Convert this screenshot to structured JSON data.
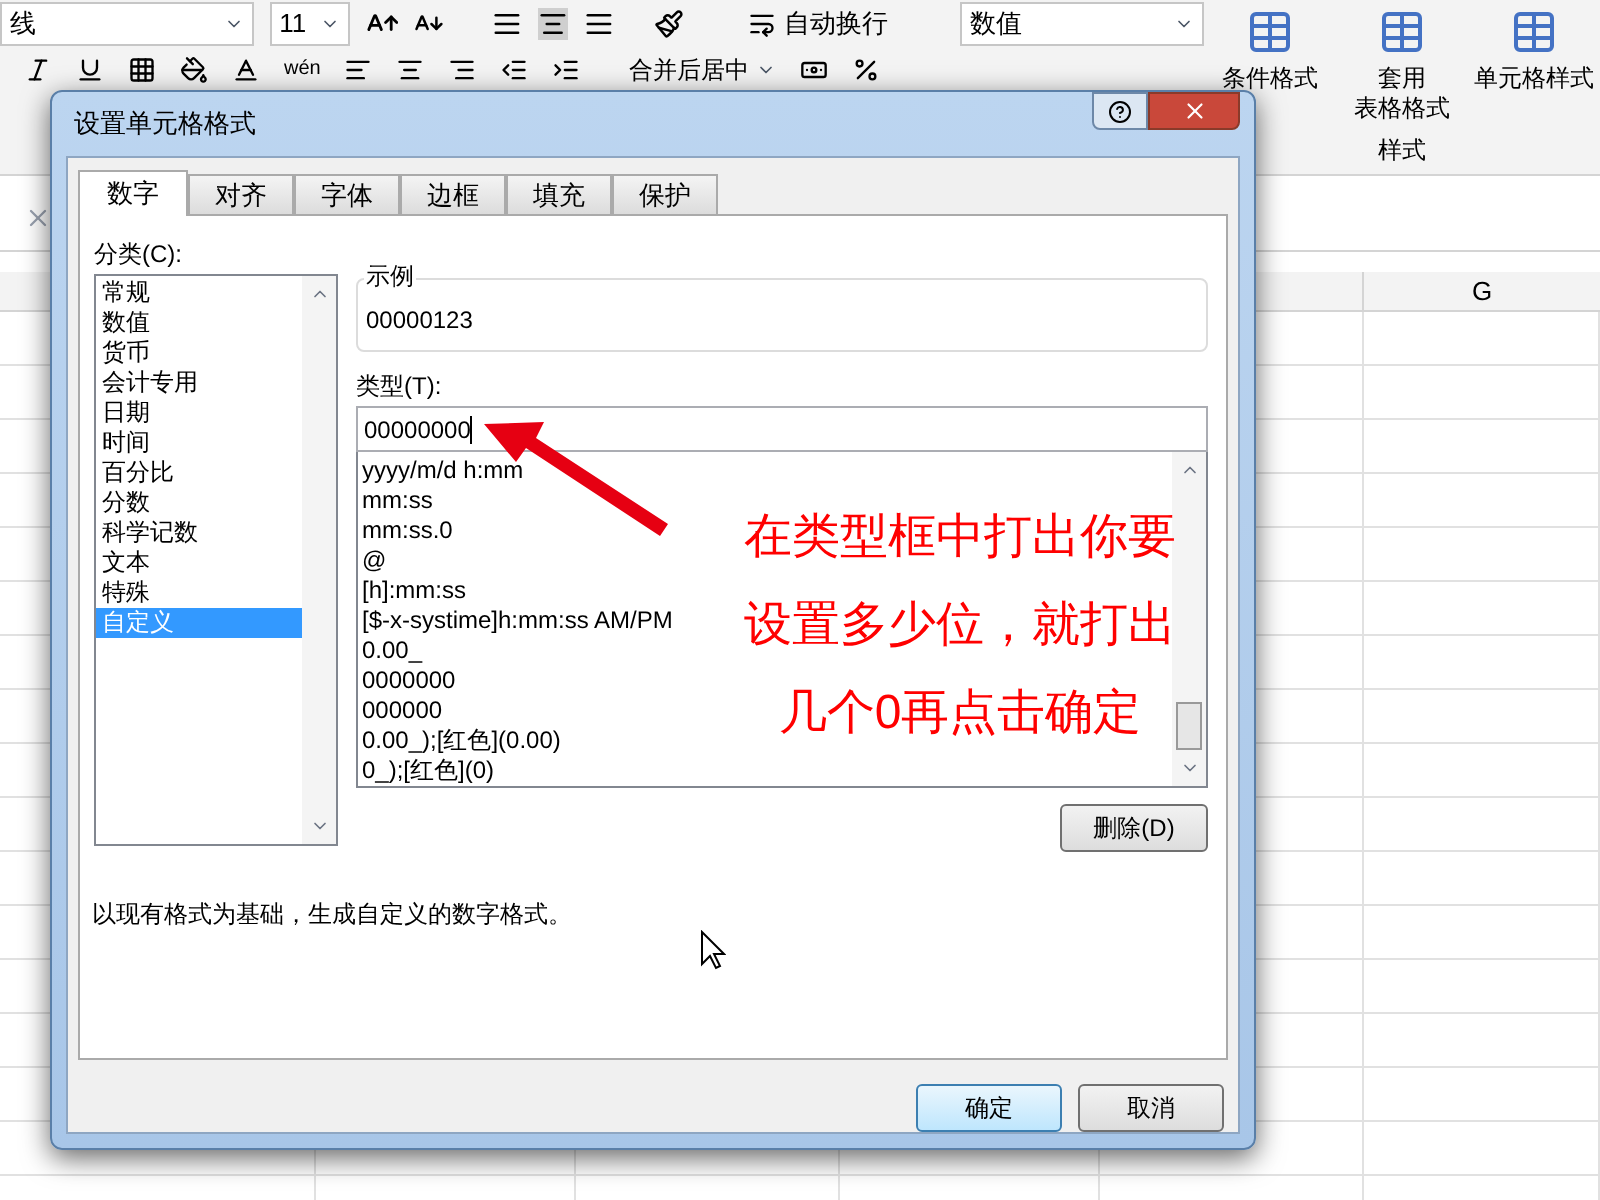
{
  "ribbon": {
    "font_name": "线",
    "font_size": "11",
    "wrap_text": "自动换行",
    "merge_center": "合并后居中",
    "number_format": "数值",
    "phonetic": "wén",
    "styles": [
      {
        "lines": [
          "条件格式"
        ]
      },
      {
        "lines": [
          "套用",
          "表格格式"
        ]
      },
      {
        "lines": [
          "单元格样式"
        ]
      }
    ],
    "group_label": "样式"
  },
  "sheet": {
    "visible_column": "G"
  },
  "dialog": {
    "title": "设置单元格格式",
    "tabs": [
      {
        "label": "数字",
        "selected": true
      },
      {
        "label": "对齐",
        "selected": false
      },
      {
        "label": "字体",
        "selected": false
      },
      {
        "label": "边框",
        "selected": false
      },
      {
        "label": "填充",
        "selected": false
      },
      {
        "label": "保护",
        "selected": false
      }
    ],
    "category_label": "分类(C):",
    "categories": [
      {
        "label": "常规",
        "selected": false
      },
      {
        "label": "数值",
        "selected": false
      },
      {
        "label": "货币",
        "selected": false
      },
      {
        "label": "会计专用",
        "selected": false
      },
      {
        "label": "日期",
        "selected": false
      },
      {
        "label": "时间",
        "selected": false
      },
      {
        "label": "百分比",
        "selected": false
      },
      {
        "label": "分数",
        "selected": false
      },
      {
        "label": "科学记数",
        "selected": false
      },
      {
        "label": "文本",
        "selected": false
      },
      {
        "label": "特殊",
        "selected": false
      },
      {
        "label": "自定义",
        "selected": true
      }
    ],
    "sample_label": "示例",
    "sample_value": "00000123",
    "type_label": "类型(T):",
    "type_value": "00000000",
    "formats": [
      "yyyy/m/d h:mm",
      "mm:ss",
      "mm:ss.0",
      "@",
      "[h]:mm:ss",
      "[$-x-systime]h:mm:ss AM/PM",
      "0.00_",
      "0000000",
      "000000",
      "0.00_);[红色](0.00)",
      "0_);[红色](0)"
    ],
    "delete_button": "删除(D)",
    "description": "以现有格式为基础，生成自定义的数字格式。",
    "ok_button": "确定",
    "cancel_button": "取消"
  },
  "annotation": {
    "lines": [
      "在类型框中打出你要",
      "设置多少位，就打出",
      "几个0再点击确定"
    ]
  }
}
